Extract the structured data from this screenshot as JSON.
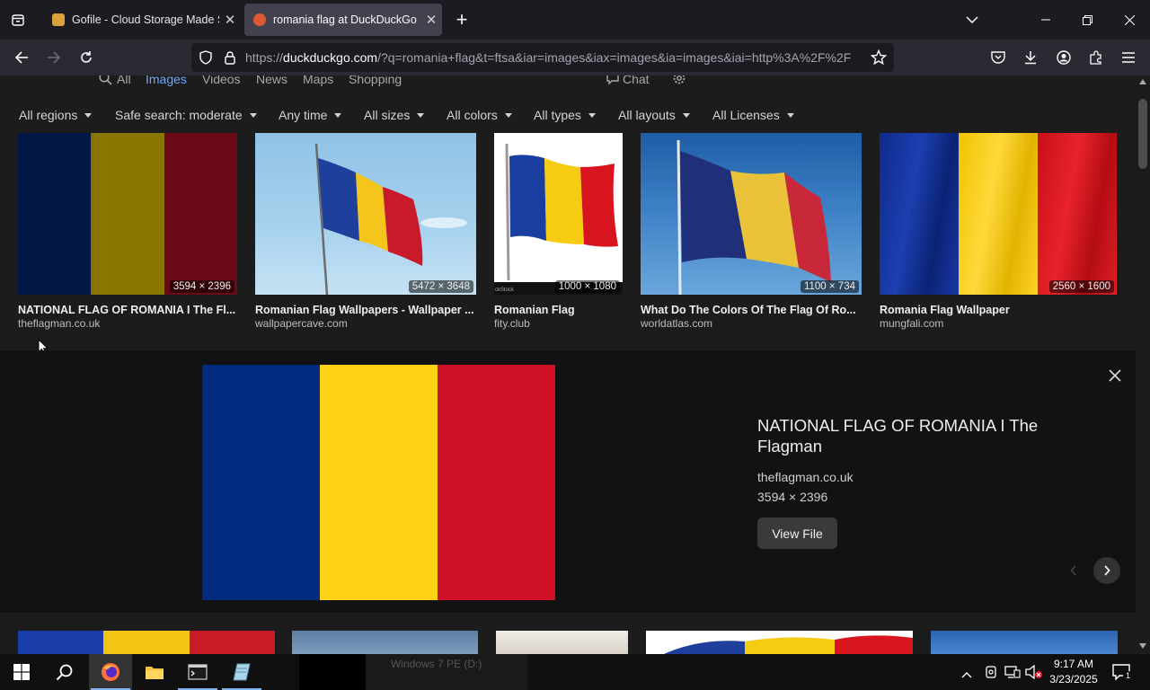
{
  "browser": {
    "tabs": [
      {
        "title": "Gofile - Cloud Storage Made Si",
        "active": false
      },
      {
        "title": "romania flag at DuckDuckGo",
        "active": true
      }
    ],
    "url_host": "duckduckgo.com",
    "url_prefix": "https://",
    "url_rest": "/?q=romania+flag&t=ftsa&iar=images&iax=images&ia=images&iai=http%3A%2F%2F"
  },
  "search": {
    "vertical_tabs": [
      "All",
      "Images",
      "Videos",
      "News",
      "Maps",
      "Shopping",
      "Chat"
    ],
    "active_tab": "Images",
    "filters": [
      "All regions",
      "Safe search: moderate",
      "Any time",
      "All sizes",
      "All colors",
      "All types",
      "All layouts",
      "All Licenses"
    ]
  },
  "results": [
    {
      "title": "NATIONAL FLAG OF ROMANIA I The Fl...",
      "source": "theflagman.co.uk",
      "dims": "3594 × 2396"
    },
    {
      "title": "Romanian Flag Wallpapers - Wallpaper ...",
      "source": "wallpapercave.com",
      "dims": "5472 × 3648"
    },
    {
      "title": "Romanian Flag",
      "source": "fity.club",
      "dims": "1000 × 1080",
      "watermark": "ckStock"
    },
    {
      "title": "What Do The Colors Of The Flag Of Ro...",
      "source": "worldatlas.com",
      "dims": "1100 × 734"
    },
    {
      "title": "Romania Flag Wallpaper",
      "source": "mungfali.com",
      "dims": "2560 × 1600"
    }
  ],
  "detail": {
    "title": "NATIONAL FLAG OF ROMANIA I The Flagman",
    "source": "theflagman.co.uk",
    "dims": "3594 × 2396",
    "button": "View File"
  },
  "flag_colors": {
    "blue": "#002B7F",
    "yellow": "#FCD116",
    "red": "#CE1126"
  },
  "taskbar": {
    "time": "9:17 AM",
    "date": "3/23/2025",
    "notification_count": "1",
    "popup_text": "Windows 7 PE (D:)"
  }
}
